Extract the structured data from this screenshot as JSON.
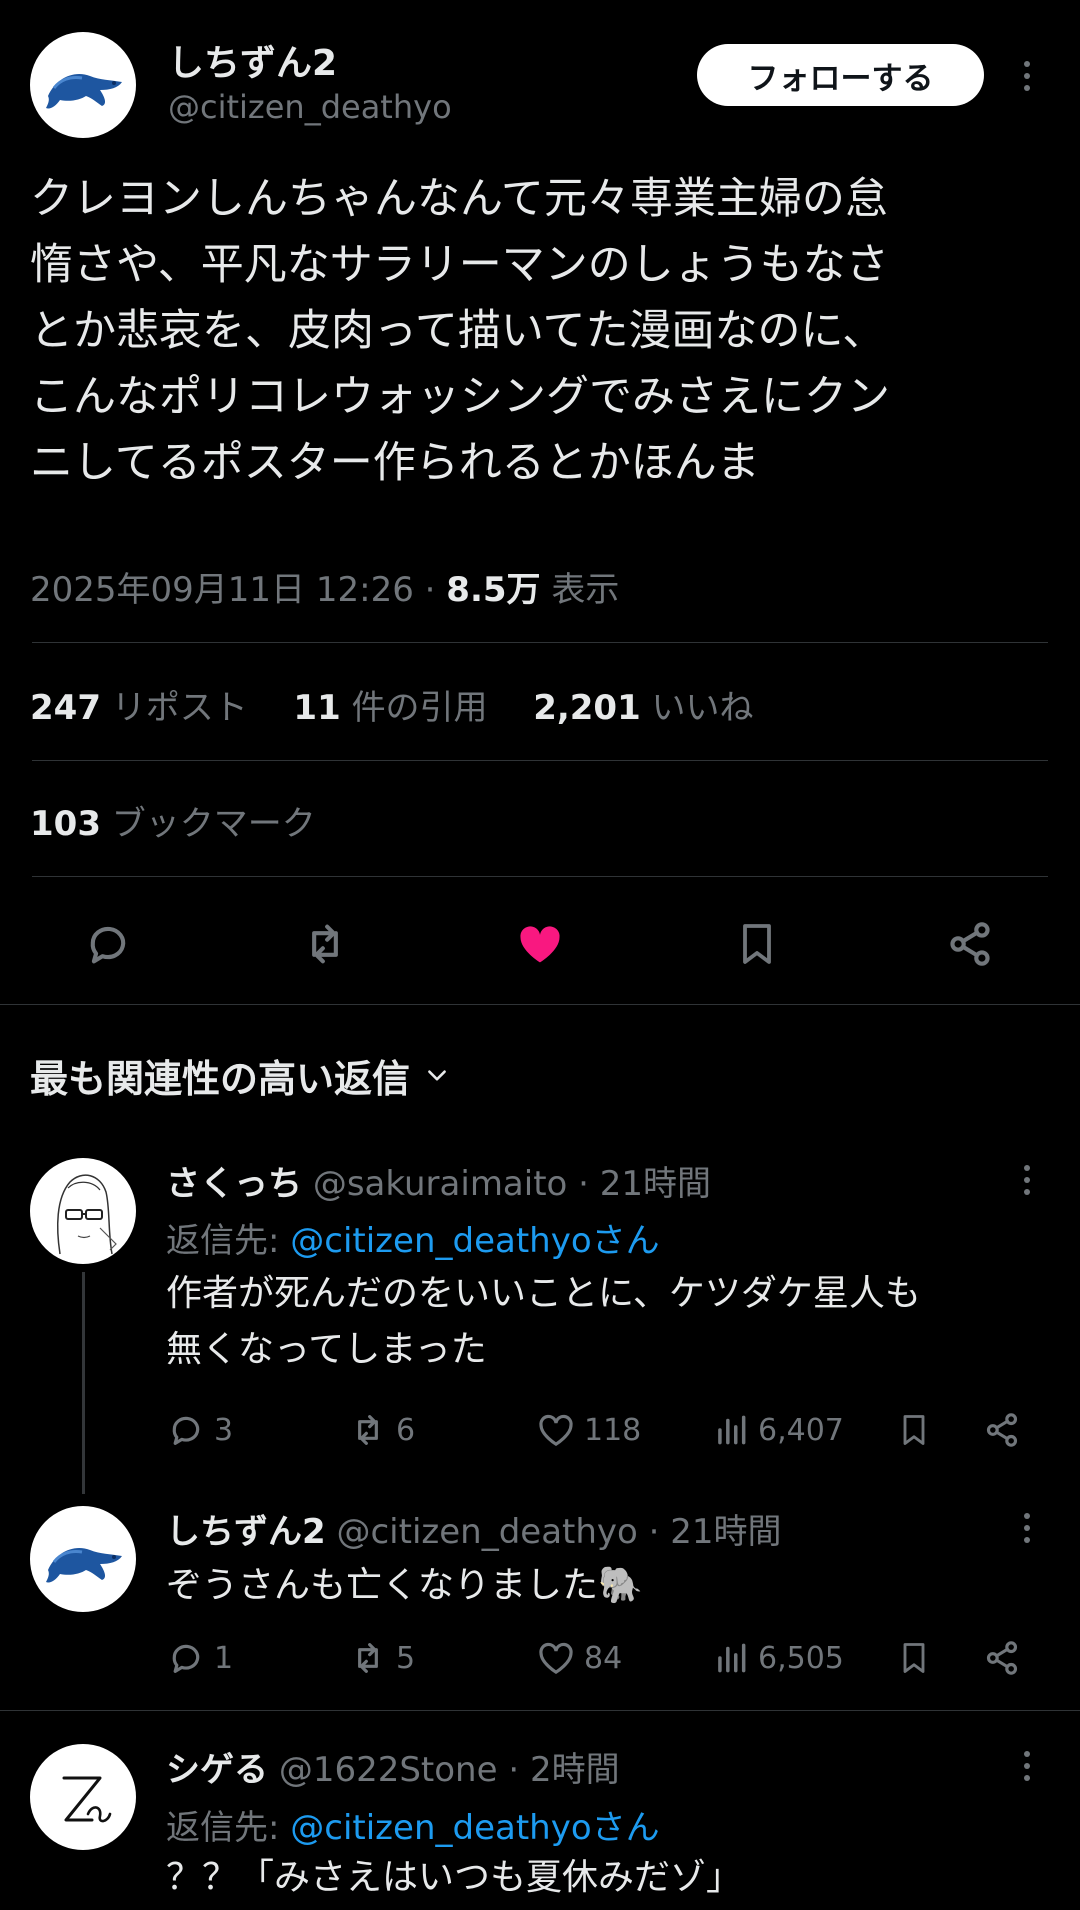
{
  "post": {
    "display_name": "しちずん2",
    "handle": "@citizen_deathyo",
    "follow_label": "フォローする",
    "text_lines": [
      "クレヨンしんちゃんなんて元々専業主婦の怠",
      "惰さや、平凡なサラリーマンのしょうもなさ",
      "とか悲哀を、皮肉って描いてた漫画なのに、",
      "こんなポリコレウォッシングでみさえにクン",
      "ニしてるポスター作られるとかほんま"
    ],
    "datetime": "2025年09月11日 12:26",
    "separator": "·",
    "views_count": "8.5万",
    "views_label": "表示",
    "reposts_count": "247",
    "reposts_label": "リポスト",
    "quotes_count": "11",
    "quotes_label": "件の引用",
    "likes_count": "2,201",
    "likes_label": "いいね",
    "bookmarks_count": "103",
    "bookmarks_label": "ブックマーク"
  },
  "colors": {
    "like_active": "#f91880",
    "link": "#1d9bf0",
    "muted": "#71767b"
  },
  "sort": {
    "label": "最も関連性の高い返信"
  },
  "replies": [
    {
      "name": "さくっち",
      "handle": "@sakuraimaito",
      "time": "· 21時間",
      "reply_prefix": "返信先: ",
      "reply_to": "@citizen_deathyoさん",
      "text_lines": [
        "作者が死んだのをいいことに、ケツダケ星人も",
        "無くなってしまった"
      ],
      "stats": {
        "replies": "3",
        "reposts": "6",
        "likes": "118",
        "views": "6,407"
      }
    },
    {
      "name": "しちずん2",
      "handle": "@citizen_deathyo",
      "time": "· 21時間",
      "text_lines": [
        "ぞうさんも亡くなりました🐘"
      ],
      "stats": {
        "replies": "1",
        "reposts": "5",
        "likes": "84",
        "views": "6,505"
      }
    },
    {
      "name": "シゲる",
      "handle": "@1622Stone",
      "time": "· 2時間",
      "reply_prefix": "返信先: ",
      "reply_to": "@citizen_deathyoさん",
      "text_lines": [
        "？？「みさえはいつも夏休みだゾ」"
      ]
    }
  ]
}
